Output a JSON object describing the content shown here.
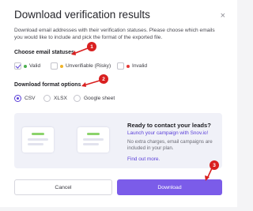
{
  "dialog": {
    "title": "Download verification results",
    "close_icon": "×",
    "description": "Download email addresses with their verification statuses. Please choose which emails you would like to include and pick the format of the exported file."
  },
  "statuses": {
    "heading": "Choose email statuses",
    "options": [
      {
        "label": "Valid",
        "checked": true,
        "color": "#4caf50"
      },
      {
        "label": "Unverifiable (Risky)",
        "checked": false,
        "color": "#f0b429"
      },
      {
        "label": "Invalid",
        "checked": false,
        "color": "#e53935"
      }
    ]
  },
  "format": {
    "heading": "Download format options",
    "options": [
      {
        "label": "CSV",
        "selected": true
      },
      {
        "label": "XLSX",
        "selected": false
      },
      {
        "label": "Google sheet",
        "selected": false
      }
    ]
  },
  "promo": {
    "title": "Ready to contact your leads?",
    "link": "Launch your campaign with Snov.io!",
    "text": "No extra charges, email campaigns are included in your plan.",
    "find_out": "Find out more."
  },
  "buttons": {
    "cancel": "Cancel",
    "download": "Download"
  },
  "annotations": [
    "1",
    "2",
    "3"
  ],
  "colors": {
    "accent": "#7b5ce9",
    "badge": "#d92020"
  }
}
